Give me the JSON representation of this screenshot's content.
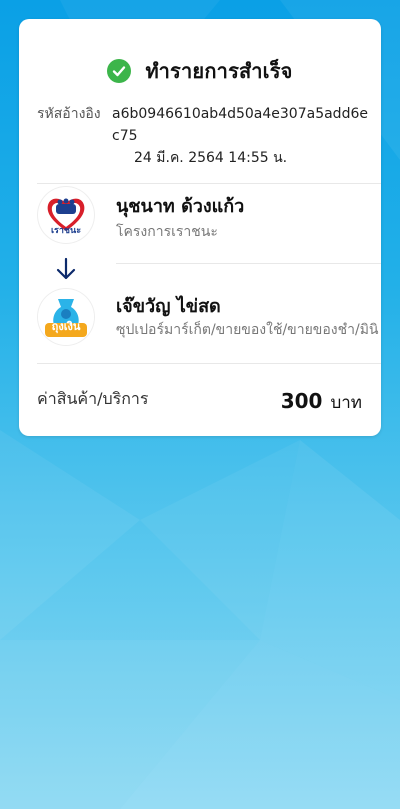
{
  "header": {
    "title": "ทำรายการสำเร็จ",
    "status_icon": "check-circle-icon",
    "status_color": "#3cb54a"
  },
  "reference": {
    "label": "รหัสอ้างอิง",
    "value": "a6b0946610ab4d50a4e307a5add6ec75",
    "datetime": "24 มี.ค. 2564 14:55 น."
  },
  "sender": {
    "name": "นุชนาท ด้วงแก้ว",
    "subtitle": "โครงการเราชนะ",
    "logo_text": "เราชนะ",
    "logo_icon": "rao-chana-logo"
  },
  "direction_icon": "arrow-down-icon",
  "receiver": {
    "name": "เจ๊ขวัญ ไข่สด",
    "subtitle": "ซุปเปอร์มาร์เก็ต/ขายของใช้/ขายของชำ/มินิ",
    "logo_text": "ถุงเงิน",
    "logo_icon": "tung-ngern-logo"
  },
  "summary": {
    "label": "ค่าสินค้า/บริการ",
    "amount": "300",
    "currency": "บาท"
  },
  "colors": {
    "accent": "#0c2a6b",
    "background": "#1fa9e6",
    "success": "#3cb54a"
  }
}
